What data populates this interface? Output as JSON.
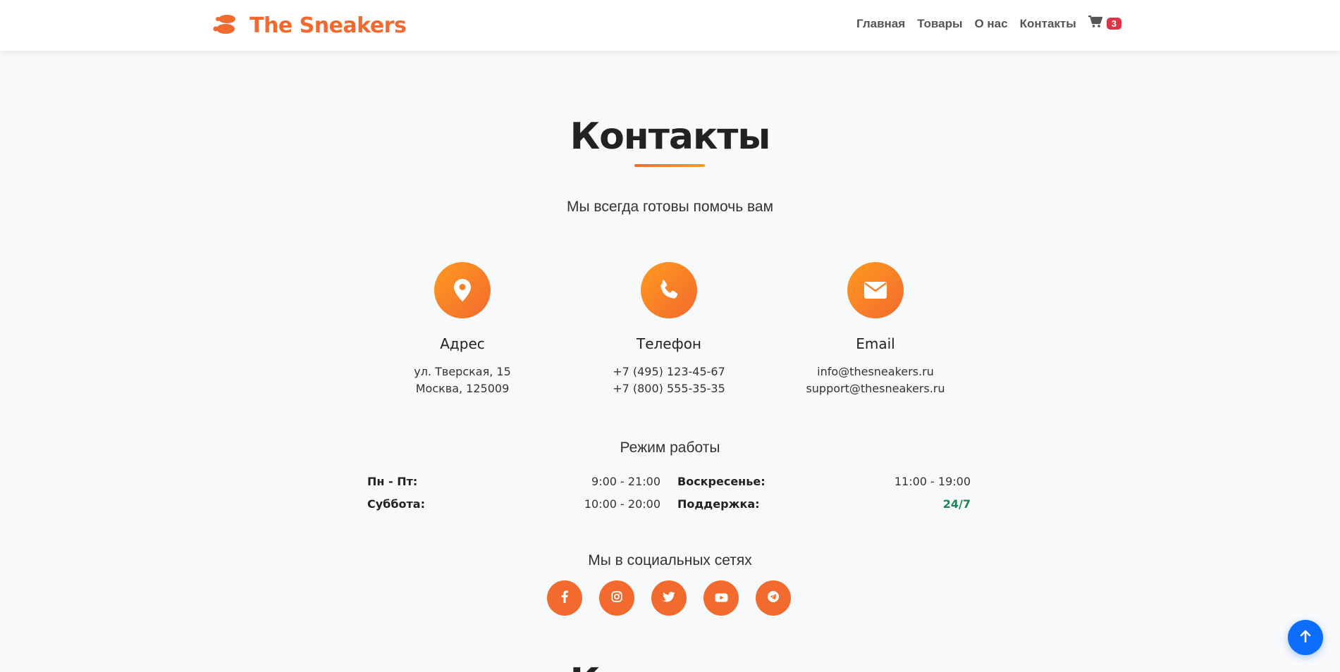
{
  "brand": {
    "name": "The Sneakers",
    "color": "#f26a2e"
  },
  "nav": {
    "items": [
      "Главная",
      "Товары",
      "О нас",
      "Контакты"
    ],
    "cart_count": "3"
  },
  "contacts": {
    "title": "Контакты",
    "subtitle": "Мы всегда готовы помочь вам",
    "cards": [
      {
        "icon": "map-marker-icon",
        "title": "Адрес",
        "lines": [
          "ул. Тверская, 15",
          "Москва, 125009"
        ]
      },
      {
        "icon": "phone-icon",
        "title": "Телефон",
        "lines": [
          "+7 (495) 123-45-67",
          "+7 (800) 555-35-35"
        ]
      },
      {
        "icon": "envelope-icon",
        "title": "Email",
        "lines": [
          "info@thesneakers.ru",
          "support@thesneakers.ru"
        ]
      }
    ]
  },
  "hours": {
    "title": "Режим работы",
    "rows": [
      {
        "day": "Пн - Пт:",
        "time": "9:00 - 21:00"
      },
      {
        "day": "Суббота:",
        "time": "10:00 - 20:00"
      },
      {
        "day": "Воскресенье:",
        "time": "11:00 - 19:00"
      },
      {
        "day": "Поддержка:",
        "time": "24/7"
      }
    ]
  },
  "social": {
    "title": "Мы в социальных сетях",
    "items": [
      "facebook-icon",
      "instagram-icon",
      "twitter-icon",
      "youtube-icon",
      "telegram-icon"
    ]
  },
  "next_section_title": "Контакты",
  "colors": {
    "accent": "#f26a2e",
    "accent_light": "#ff9a1f",
    "badge": "#dc3545",
    "back_to_top": "#0d6efd",
    "success": "#198754"
  }
}
